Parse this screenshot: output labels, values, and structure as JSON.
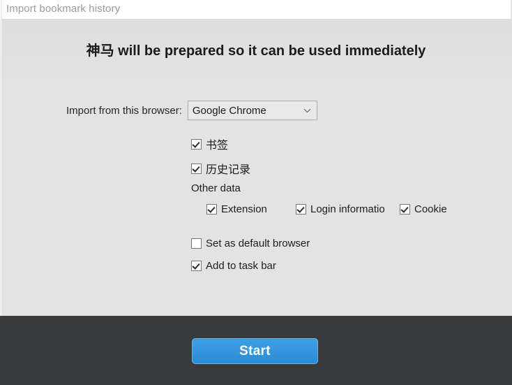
{
  "titlebar": {
    "title": "Import bookmark history"
  },
  "heading": "神马 will be prepared so it can be used immediately",
  "browser_select": {
    "label": "Import from this browser:",
    "value": "Google Chrome",
    "arrow_icon": "chevron-down-icon"
  },
  "import_options": [
    {
      "label": "书签",
      "checked": true
    },
    {
      "label": "历史记录",
      "checked": true
    }
  ],
  "other_data": {
    "label": "Other data",
    "items": [
      {
        "label": "Extension",
        "checked": true
      },
      {
        "label": "Login informatio",
        "checked": true
      },
      {
        "label": "Cookie",
        "checked": true
      }
    ]
  },
  "settings": [
    {
      "label": "Set as default browser",
      "checked": false
    },
    {
      "label": "Add to task bar",
      "checked": true
    }
  ],
  "footer": {
    "start_label": "Start"
  },
  "colors": {
    "accent": "#3496dd",
    "accent_border": "#69b6ec",
    "body_background": "#e3e3e3",
    "footer_background": "#393a3c",
    "titlebar_background": "#ffffff",
    "titlebar_text": "#9b9b9b",
    "heading_text": "#1b1b1b",
    "checkbox_border": "#767676",
    "select_border": "#acacac"
  }
}
